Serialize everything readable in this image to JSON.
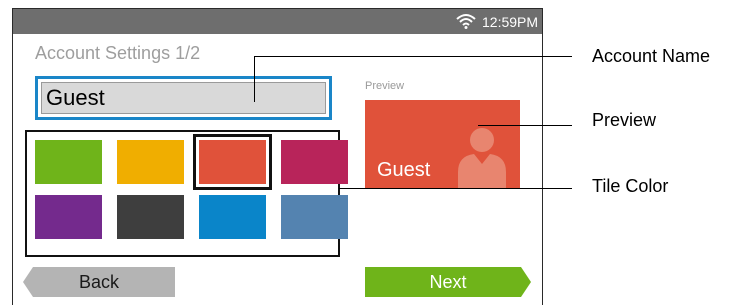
{
  "status": {
    "time": "12:59PM"
  },
  "screen": {
    "title": "Account Settings 1/2",
    "account_name_value": "Guest",
    "preview_label": "Preview",
    "preview_name": "Guest",
    "selected_color": "#e0523a"
  },
  "palette": [
    {
      "name": "green",
      "color": "#6fb41a"
    },
    {
      "name": "yellow",
      "color": "#f0ae00"
    },
    {
      "name": "red",
      "color": "#e0523a",
      "selected": true
    },
    {
      "name": "pink",
      "color": "#b8245a"
    },
    {
      "name": "purple",
      "color": "#742a8d"
    },
    {
      "name": "gray",
      "color": "#3e3e3e"
    },
    {
      "name": "blue",
      "color": "#0a85c9"
    },
    {
      "name": "steel",
      "color": "#5483b0"
    }
  ],
  "buttons": {
    "back": "Back",
    "next": "Next"
  },
  "callouts": {
    "account_name": "Account Name",
    "preview": "Preview",
    "tile_color": "Tile Color"
  }
}
